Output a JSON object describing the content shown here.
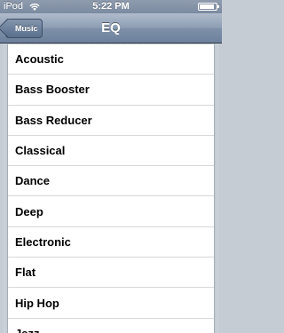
{
  "status_bar": {
    "carrier": "iPod",
    "time": "5:22 PM",
    "battery_level": 0.9
  },
  "nav": {
    "title": "EQ",
    "back_label": "Music"
  },
  "list": {
    "items": [
      "Acoustic",
      "Bass Booster",
      "Bass Reducer",
      "Classical",
      "Dance",
      "Deep",
      "Electronic",
      "Flat",
      "Hip Hop",
      "Jazz"
    ]
  },
  "icons": {
    "wifi": "wifi-icon",
    "battery": "battery-icon",
    "back": "back-chevron-icon"
  }
}
